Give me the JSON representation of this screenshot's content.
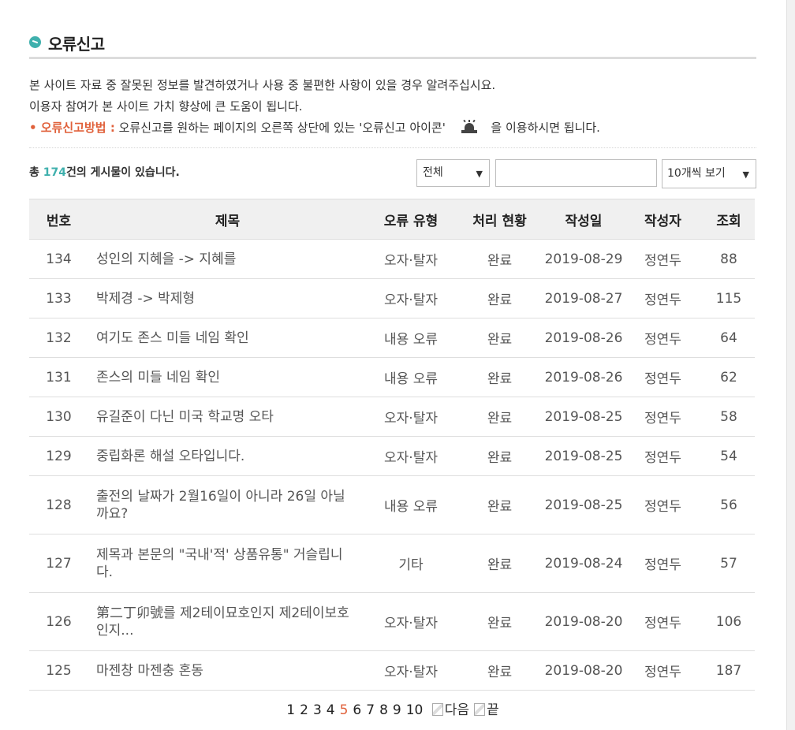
{
  "page": {
    "title": "오류신고"
  },
  "intro": {
    "line1": "본 사이트 자료 중 잘못된 정보를 발견하였거나 사용 중 불편한 사항이 있을 경우 알려주십시요.",
    "line2": "이용자 참여가 본 사이트 가치 향상에 큰 도움이 됩니다.",
    "method_label": "• 오류신고방법 :",
    "method_text": "오류신고를 원하는 페이지의 오른쪽 상단에 있는 '오류신고 아이콘'",
    "method_suffix": "을 이용하시면 됩니다.",
    "alarm_icon": "siren-icon"
  },
  "toolbar": {
    "total_prefix": "총 ",
    "total_count": "174",
    "total_suffix": "건의 게시물이 있습니다.",
    "filter_value": "전체",
    "search_value": "",
    "perpage_value": "10개씩 보기"
  },
  "table": {
    "headers": [
      "번호",
      "제목",
      "오류 유형",
      "처리 현황",
      "작성일",
      "작성자",
      "조회"
    ],
    "rows": [
      {
        "no": "134",
        "title": "성인의 지혜을 -> 지혜를",
        "type": "오자·탈자",
        "status": "완료",
        "date": "2019-08-29",
        "author": "정연두",
        "views": "88"
      },
      {
        "no": "133",
        "title": "박제경 -> 박제형",
        "type": "오자·탈자",
        "status": "완료",
        "date": "2019-08-27",
        "author": "정연두",
        "views": "115"
      },
      {
        "no": "132",
        "title": "여기도 존스 미들 네임 확인",
        "type": "내용 오류",
        "status": "완료",
        "date": "2019-08-26",
        "author": "정연두",
        "views": "64"
      },
      {
        "no": "131",
        "title": "존스의 미들 네임 확인",
        "type": "내용 오류",
        "status": "완료",
        "date": "2019-08-26",
        "author": "정연두",
        "views": "62"
      },
      {
        "no": "130",
        "title": "유길준이 다닌 미국 학교명 오타",
        "type": "오자·탈자",
        "status": "완료",
        "date": "2019-08-25",
        "author": "정연두",
        "views": "58"
      },
      {
        "no": "129",
        "title": "중립화론 해설 오타입니다.",
        "type": "오자·탈자",
        "status": "완료",
        "date": "2019-08-25",
        "author": "정연두",
        "views": "54"
      },
      {
        "no": "128",
        "title": "출전의 날짜가 2월16일이 아니라 26일 아닐까요?",
        "type": "내용 오류",
        "status": "완료",
        "date": "2019-08-25",
        "author": "정연두",
        "views": "56"
      },
      {
        "no": "127",
        "title": "제목과 본문의 \"국내'적' 상품유통\" 거슬립니다.",
        "type": "기타",
        "status": "완료",
        "date": "2019-08-24",
        "author": "정연두",
        "views": "57"
      },
      {
        "no": "126",
        "title": "第二丁卯號를 제2테이묘호인지 제2테이보호인지...",
        "type": "오자·탈자",
        "status": "완료",
        "date": "2019-08-20",
        "author": "정연두",
        "views": "106"
      },
      {
        "no": "125",
        "title": "마젠창 마젠충 혼동",
        "type": "오자·탈자",
        "status": "완료",
        "date": "2019-08-20",
        "author": "정연두",
        "views": "187"
      }
    ]
  },
  "pager": {
    "pages": [
      "1",
      "2",
      "3",
      "4",
      "5",
      "6",
      "7",
      "8",
      "9",
      "10"
    ],
    "current": "5",
    "next_label": "다음",
    "last_label": "끝"
  },
  "colors": {
    "accent_teal": "#3fb0ad",
    "accent_orange": "#e0603a",
    "header_bg": "#f0f0f0"
  }
}
